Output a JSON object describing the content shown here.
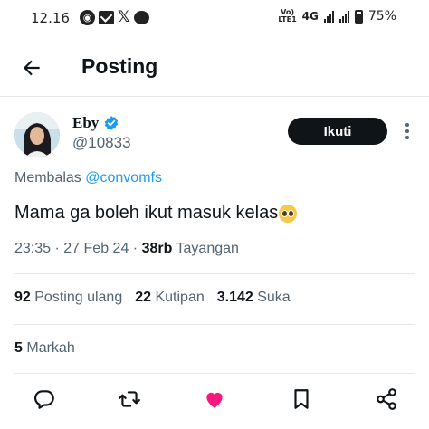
{
  "status_bar": {
    "time": "12.16",
    "volte_label": "Vo)\nLTE1",
    "network": "4G",
    "battery": "75%"
  },
  "header": {
    "title": "Posting",
    "back_icon": "arrow-left-icon"
  },
  "author": {
    "name": "Eby",
    "handle": "@10833",
    "verified": true,
    "follow_label": "Ikuti"
  },
  "post": {
    "reply_prefix": "Membalas",
    "reply_to": "@convomfs",
    "text": "Mama ga boleh ikut masuk kelas",
    "emoji": "pleading-face",
    "time": "23:35",
    "date": "27 Feb 24",
    "views": "38rb",
    "views_label": "Tayangan"
  },
  "stats": {
    "reposts": "92",
    "reposts_label": "Posting ulang",
    "quotes": "22",
    "quotes_label": "Kutipan",
    "likes": "3.142",
    "likes_label": "Suka",
    "bookmarks": "5",
    "bookmarks_label": "Markah"
  },
  "actions": [
    {
      "icon": "reply-icon"
    },
    {
      "icon": "repost-icon"
    },
    {
      "icon": "like-icon",
      "color": "#f91880"
    },
    {
      "icon": "bookmark-icon"
    },
    {
      "icon": "share-icon"
    }
  ],
  "colors": {
    "link": "#1d9bf0",
    "like_active": "#f91880",
    "verified": "#1d9bf0",
    "text_primary": "#0f1419",
    "text_secondary": "#536471"
  }
}
